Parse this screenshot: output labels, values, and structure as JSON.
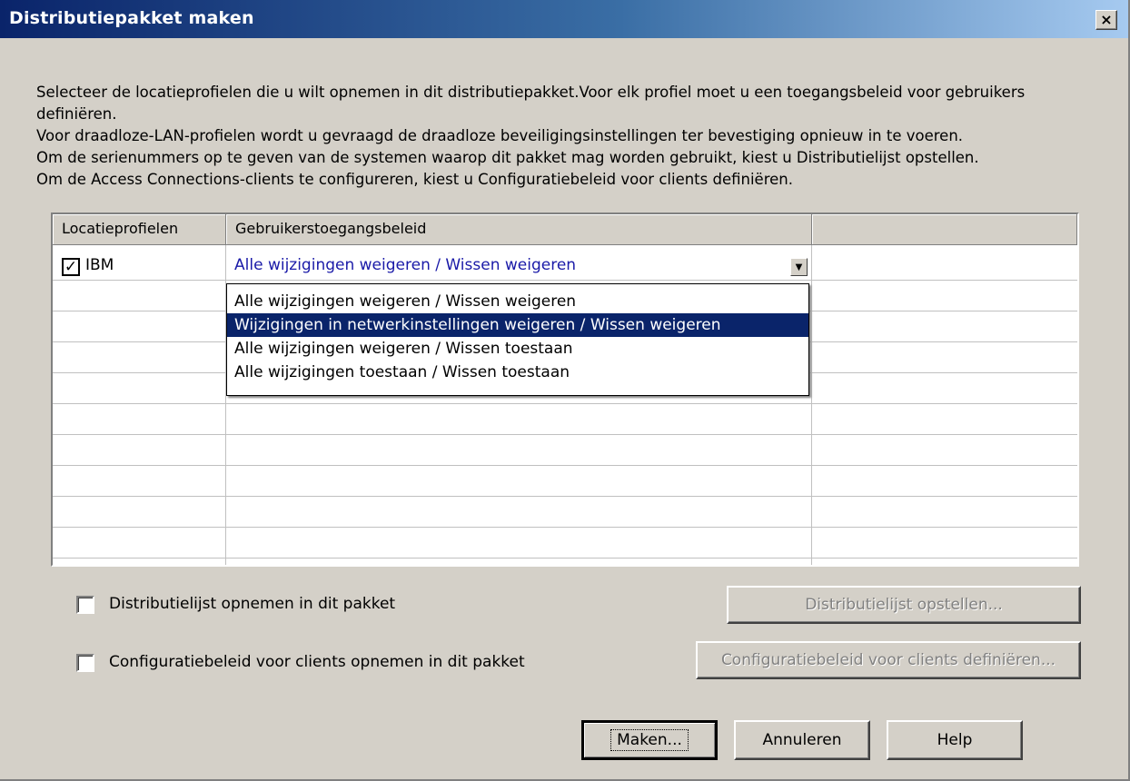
{
  "window": {
    "title": "Distributiepakket maken",
    "close_label": "×"
  },
  "description": {
    "line1": "Selecteer de locatieprofielen die u wilt opnemen in dit distributiepakket.Voor elk profiel moet u een toegangsbeleid voor gebruikers definiëren.",
    "line2": "Voor draadloze-LAN-profielen wordt u gevraagd de draadloze beveiligingsinstellingen ter bevestiging opnieuw in te voeren.",
    "line3": "Om de serienummers op te geven van de systemen waarop dit pakket mag worden gebruikt, kiest u Distributielijst opstellen.",
    "line4": "Om de Access Connections-clients te configureren, kiest u Configuratiebeleid voor clients definiëren."
  },
  "grid": {
    "columns": [
      "Locatieprofielen",
      "Gebruikerstoegangsbeleid",
      ""
    ],
    "rows": [
      {
        "checked": true,
        "check_glyph": "✓",
        "profile": "IBM",
        "policy": "Alle wijzigingen weigeren / Wissen weigeren"
      }
    ],
    "dropdown_arrow": "▼",
    "dropdown_options": [
      "Alle wijzigingen weigeren / Wissen weigeren",
      "Wijzigingen in netwerkinstellingen weigeren / Wissen weigeren",
      "Alle wijzigingen weigeren / Wissen toestaan",
      "Alle wijzigingen toestaan / Wissen toestaan"
    ],
    "highlighted_option": 1
  },
  "options": {
    "include_distribution_list": {
      "label": "Distributielijst opnemen in dit pakket",
      "checked": false
    },
    "include_client_policy": {
      "label": "Configuratiebeleid voor clients opnemen in dit pakket",
      "checked": false
    }
  },
  "buttons": {
    "create_distribution_list": "Distributielijst opstellen...",
    "define_client_policy": "Configuratiebeleid voor clients definiëren...",
    "make": "Maken...",
    "cancel": "Annuleren",
    "help": "Help"
  },
  "colors": {
    "title_gradient_start": "#0a246a",
    "title_gradient_end": "#a6caf0",
    "selection_highlight": "#0a246a",
    "policy_value_text": "#1a1aa8",
    "dialog_face": "#d4d0c8"
  }
}
